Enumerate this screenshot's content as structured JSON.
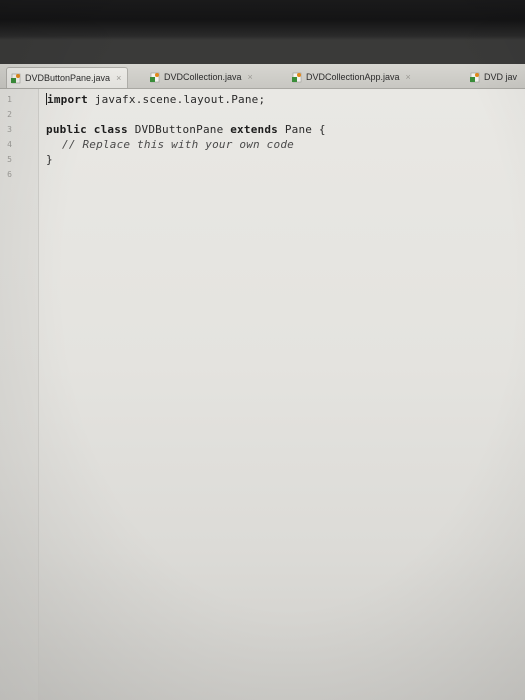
{
  "tabs": [
    {
      "label": "DVDButtonPane.java",
      "active": true,
      "close": "×"
    },
    {
      "label": "DVDCollection.java",
      "active": false,
      "close": "×"
    },
    {
      "label": "DVDCollectionApp.java",
      "active": false,
      "close": "×"
    },
    {
      "label": "DVD jav",
      "active": false,
      "close": ""
    }
  ],
  "editor": {
    "line_numbers": [
      "1",
      "2",
      "3",
      "4",
      "5",
      "6"
    ],
    "lines": {
      "l1_kw": "import",
      "l1_rest": " javafx.scene.layout.Pane;",
      "l3_kw1": "public",
      "l3_gap1": " ",
      "l3_kw2": "class",
      "l3_mid": " DVDButtonPane ",
      "l3_kw3": "extends",
      "l3_rest": " Pane {",
      "l4_comment": "// Replace this with your own code",
      "l5_brace": "}"
    }
  },
  "colors": {
    "tabbar": "#c8c7c2",
    "editor_bg": "#e6e5e1",
    "java_icon_orange": "#e2891b",
    "java_icon_green": "#3a8d3a"
  },
  "icons": {
    "tab_file": "java-file-icon"
  }
}
